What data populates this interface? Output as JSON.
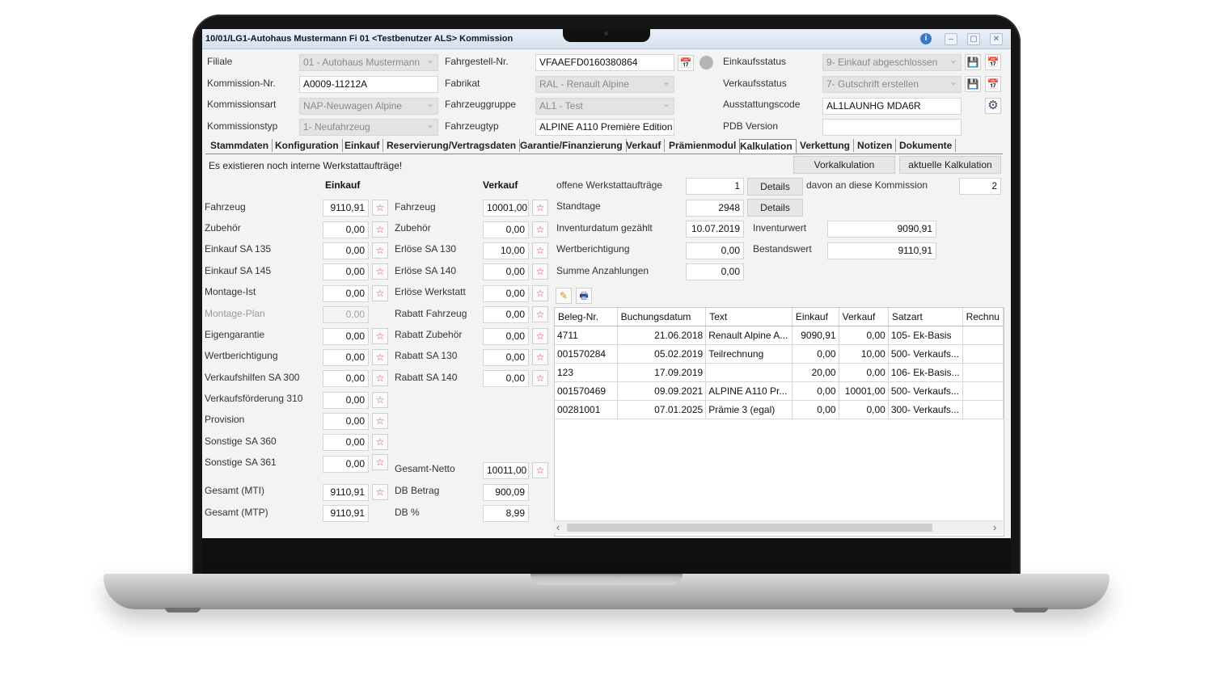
{
  "window": {
    "title": "10/01/LG1-Autohaus Mustermann Fi 01 <Testbenutzer ALS> Kommission",
    "info_icon": "i",
    "minimize_icon": "–",
    "maximize_icon": "▢",
    "close_icon": "✕"
  },
  "header": {
    "filiale_label": "Filiale",
    "filiale_value": "01 - Autohaus Mustermann",
    "kommission_nr_label": "Kommission-Nr.",
    "kommission_nr_value": "A0009-11212A",
    "kommissionsart_label": "Kommissionsart",
    "kommissionsart_value": "NAP-Neuwagen Alpine",
    "kommissionstyp_label": "Kommissionstyp",
    "kommissionstyp_value": "1- Neufahrzeug",
    "fahrgestell_label": "Fahrgestell-Nr.",
    "fahrgestell_value": "VFAAEFD0160380864",
    "fabrikat_label": "Fabrikat",
    "fabrikat_value": "RAL - Renault Alpine",
    "fahrzeuggruppe_label": "Fahrzeuggruppe",
    "fahrzeuggruppe_value": "AL1 - Test",
    "fahrzeugtyp_label": "Fahrzeugtyp",
    "fahrzeugtyp_value": "ALPINE A110 Première Edition",
    "einkaufsstatus_label": "Einkaufsstatus",
    "einkaufsstatus_value": "9- Einkauf abgeschlossen",
    "verkaufsstatus_label": "Verkaufsstatus",
    "verkaufsstatus_value": "7- Gutschrift erstellen",
    "ausstattungscode_label": "Ausstattungscode",
    "ausstattungscode_value": "AL1LAUNHG MDA6R",
    "pdb_version_label": "PDB Version",
    "pdb_version_value": ""
  },
  "tabs": [
    {
      "label": "Stammdaten"
    },
    {
      "label": "Konfiguration"
    },
    {
      "label": "Einkauf"
    },
    {
      "label": "Reservierung/Vertragsdaten"
    },
    {
      "label": "Garantie/Finanzierung"
    },
    {
      "label": "Verkauf"
    },
    {
      "label": "Prämienmodul"
    },
    {
      "label": "Kalkulation"
    },
    {
      "label": "Verkettung"
    },
    {
      "label": "Notizen"
    },
    {
      "label": "Dokumente"
    }
  ],
  "active_tab": "Kalkulation",
  "notice": "Es existieren noch interne Werkstattaufträge!",
  "buttons": {
    "vorkalkulation": "Vorkalkulation",
    "aktuelle_kalkulation": "aktuelle Kalkulation",
    "details": "Details"
  },
  "einkauf": {
    "header": "Einkauf",
    "rows": [
      {
        "label": "Fahrzeug",
        "value": "9110,91"
      },
      {
        "label": "Zubehör",
        "value": "0,00"
      },
      {
        "label": "Einkauf SA 135",
        "value": "0,00"
      },
      {
        "label": "Einkauf SA 145",
        "value": "0,00"
      },
      {
        "label": "Montage-Ist",
        "value": "0,00"
      },
      {
        "label": "Montage-Plan",
        "value": "0,00"
      },
      {
        "label": "Eigengarantie",
        "value": "0,00"
      },
      {
        "label": "Wertberichtigung",
        "value": "0,00"
      },
      {
        "label": "Verkaufshilfen SA 300",
        "value": "0,00"
      },
      {
        "label": "Verkaufsförderung 310",
        "value": "0,00"
      },
      {
        "label": "Provision",
        "value": "0,00"
      },
      {
        "label": "Sonstige SA 360",
        "value": "0,00"
      },
      {
        "label": "Sonstige SA 361",
        "value": "0,00"
      }
    ],
    "gesamt_mti_label": "Gesamt (MTI)",
    "gesamt_mti_value": "9110,91",
    "gesamt_mtp_label": "Gesamt (MTP)",
    "gesamt_mtp_value": "9110,91"
  },
  "verkauf": {
    "header": "Verkauf",
    "rows": [
      {
        "label": "Fahrzeug",
        "value": "10001,00"
      },
      {
        "label": "Zubehör",
        "value": "0,00"
      },
      {
        "label": "Erlöse SA 130",
        "value": "10,00"
      },
      {
        "label": "Erlöse SA 140",
        "value": "0,00"
      },
      {
        "label": "Erlöse Werkstatt",
        "value": "0,00"
      },
      {
        "label": "Rabatt Fahrzeug",
        "value": "0,00"
      },
      {
        "label": "Rabatt Zubehör",
        "value": "0,00"
      },
      {
        "label": "Rabatt SA 130",
        "value": "0,00"
      },
      {
        "label": "Rabatt SA 140",
        "value": "0,00"
      }
    ],
    "gesamt_netto_label": "Gesamt-Netto",
    "gesamt_netto_value": "10011,00",
    "db_betrag_label": "DB Betrag",
    "db_betrag_value": "900,09",
    "db_prozent_label": "DB %",
    "db_prozent_value": "8,99"
  },
  "info": {
    "offene_label": "offene Werkstattaufträge",
    "offene_value": "1",
    "davon_label": "davon an diese Kommission",
    "davon_value": "2",
    "standtage_label": "Standtage",
    "standtage_value": "2948",
    "inventurdatum_label": "Inventurdatum gezählt",
    "inventurdatum_value": "10.07.2019",
    "inventurwert_label": "Inventurwert",
    "inventurwert_value": "9090,91",
    "wertberichtigung_label": "Wertberichtigung",
    "wertberichtigung_value": "0,00",
    "bestandswert_label": "Bestandswert",
    "bestandswert_value": "9110,91",
    "anzahlungen_label": "Summe Anzahlungen",
    "anzahlungen_value": "0,00"
  },
  "table": {
    "columns": [
      "Beleg-Nr.",
      "Buchungsdatum",
      "Text",
      "Einkauf",
      "Verkauf",
      "Satzart",
      "Rechnu"
    ],
    "rows": [
      [
        "4711",
        "21.06.2018",
        "Renault Alpine A...",
        "9090,91",
        "0,00",
        "105- Ek-Basis",
        ""
      ],
      [
        "001570284",
        "05.02.2019",
        "Teilrechnung",
        "0,00",
        "10,00",
        "500- Verkaufs...",
        ""
      ],
      [
        "123",
        "17.09.2019",
        "",
        "20,00",
        "0,00",
        "106- Ek-Basis...",
        ""
      ],
      [
        "001570469",
        "09.09.2021",
        "ALPINE A110 Pr...",
        "0,00",
        "10001,00",
        "500- Verkaufs...",
        ""
      ],
      [
        "00281001",
        "07.01.2025",
        "Prämie 3 (egal)",
        "0,00",
        "0,00",
        "300- Verkaufs...",
        ""
      ]
    ]
  },
  "icons": {
    "calc": "☆",
    "edit": "✎",
    "print": "🖶",
    "gear": "⚙",
    "save": "💾",
    "calendar": "📅",
    "scroll_left": "‹",
    "scroll_right": "›"
  },
  "colors": {
    "titlebar": "#d6e1ee",
    "calc_icon": "#d0404a",
    "info": "#3d78c8"
  }
}
